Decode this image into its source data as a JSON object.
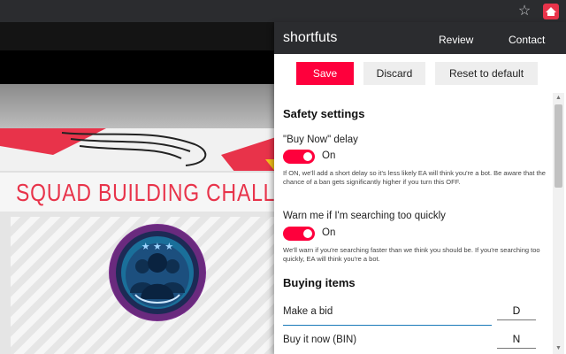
{
  "browser": {
    "bookmark_icon": "star-icon",
    "extension_icon": "shortfuts-extension-icon",
    "extension_color": "#e8334a"
  },
  "background_site": {
    "banner_text": "SQUAD BUILDING CHALLENG"
  },
  "popup": {
    "title": "shortfuts",
    "nav": {
      "review": "Review",
      "contact": "Contact"
    },
    "actions": {
      "save": "Save",
      "discard": "Discard",
      "reset": "Reset to default"
    },
    "accent_color": "#fe003c",
    "safety": {
      "heading": "Safety settings",
      "buy_now_delay": {
        "label": "\"Buy Now\" delay",
        "enabled": true,
        "state_text": "On",
        "help": "If ON, we'll add a short delay so it's less likely EA will think you're a bot. Be aware that the chance of a ban gets significantly higher if you turn this OFF."
      },
      "warn_searching": {
        "label": "Warn me if I'm searching too quickly",
        "enabled": true,
        "state_text": "On",
        "help": "We'll warn if you're searching faster than we think you should be. If you're searching too quickly, EA will think you're a bot."
      }
    },
    "buying": {
      "heading": "Buying items",
      "rows": [
        {
          "label": "Make a bid",
          "value": "D"
        },
        {
          "label": "Buy it now (BIN)",
          "value": "N"
        }
      ]
    }
  }
}
